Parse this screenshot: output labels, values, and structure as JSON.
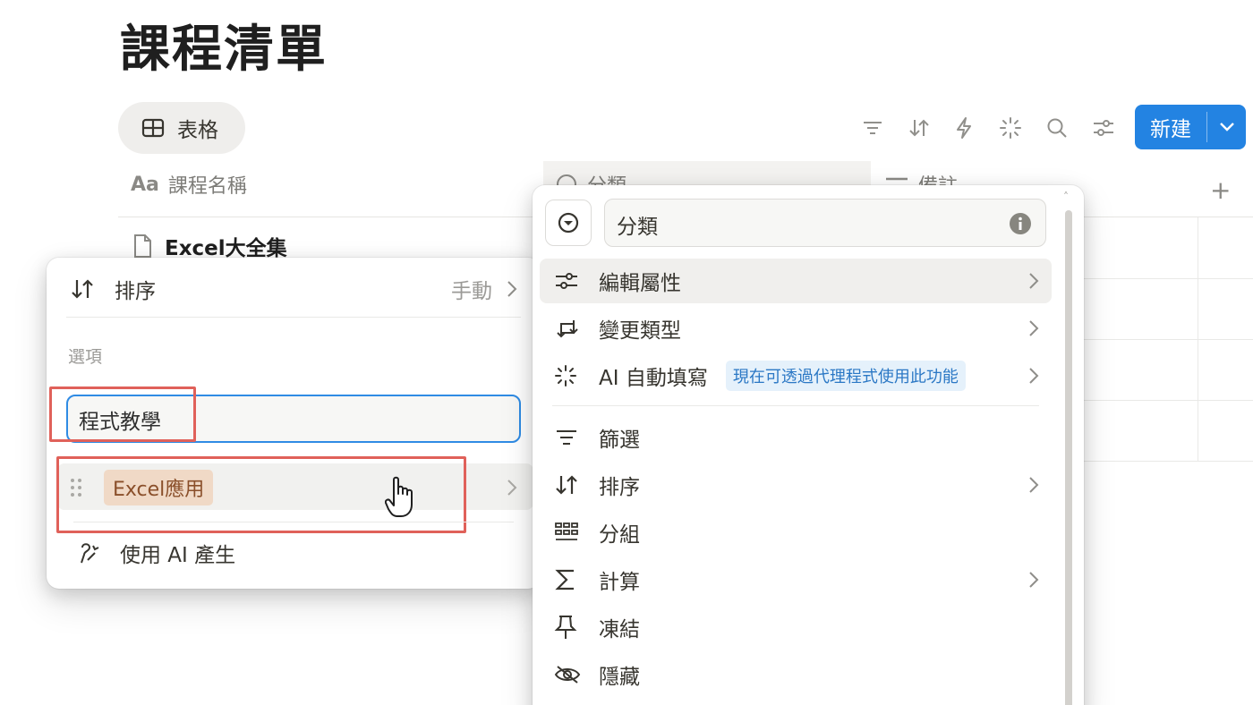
{
  "page": {
    "title": "課程清單"
  },
  "view": {
    "tab_label": "表格"
  },
  "toolbar": {
    "icons": [
      "filter-icon",
      "sort-icon",
      "automation-icon",
      "ai-icon",
      "search-icon",
      "settings-icon"
    ],
    "new_button_label": "新建"
  },
  "table": {
    "columns": [
      {
        "icon": "Aa",
        "label": "課程名稱"
      },
      {
        "icon": "select-icon",
        "label": "分類"
      },
      {
        "icon": "text-icon",
        "label": "備註"
      }
    ],
    "rows": [
      {
        "name": "Excel大全集"
      }
    ],
    "add_column": "+"
  },
  "select_menu": {
    "sort_label": "排序",
    "sort_value": "手動",
    "options_heading": "選項",
    "option_input_value": "程式教學",
    "options": [
      {
        "label": "Excel應用",
        "color": "#f0d9c6"
      }
    ],
    "ai_generate_label": "使用 AI 產生"
  },
  "property_menu": {
    "name_value": "分類",
    "items": [
      {
        "icon": "settings-icon",
        "label": "編輯屬性",
        "submenu": true
      },
      {
        "icon": "change-type-icon",
        "label": "變更類型",
        "submenu": true
      },
      {
        "icon": "ai-icon",
        "label": "AI 自動填寫",
        "badge": "現在可透過代理程式使用此功能",
        "submenu": true
      },
      {
        "icon": "filter-icon",
        "label": "篩選",
        "submenu": false
      },
      {
        "icon": "sort-icon",
        "label": "排序",
        "submenu": true
      },
      {
        "icon": "group-icon",
        "label": "分組",
        "submenu": false
      },
      {
        "icon": "sigma-icon",
        "label": "計算",
        "submenu": true
      },
      {
        "icon": "pin-icon",
        "label": "凍結",
        "submenu": false
      },
      {
        "icon": "hide-icon",
        "label": "隱藏",
        "submenu": false
      }
    ]
  },
  "colors": {
    "accent": "#2383e2",
    "highlight_box": "#e0615a"
  }
}
